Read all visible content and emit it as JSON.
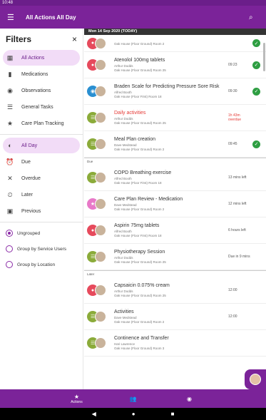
{
  "statusbar": {
    "time": "10:48"
  },
  "appbar": {
    "title": "All Actions All Day"
  },
  "drawer": {
    "title": "Filters",
    "close": "×",
    "items": [
      {
        "label": "All Actions",
        "icon": "grid-icon",
        "glyph": "▦",
        "active": true
      },
      {
        "label": "Medications",
        "icon": "pill-bottle-icon",
        "glyph": "▮",
        "active": false
      },
      {
        "label": "Observations",
        "icon": "eye-icon",
        "glyph": "◉",
        "active": false
      },
      {
        "label": "General Tasks",
        "icon": "checklist-icon",
        "glyph": "☰",
        "active": false
      },
      {
        "label": "Care Plan Tracking",
        "icon": "star-icon",
        "glyph": "★",
        "active": false
      },
      {
        "label": "All Day",
        "icon": "day-icon",
        "glyph": "◐",
        "active": true
      },
      {
        "label": "Due",
        "icon": "alarm-icon",
        "glyph": "⏰",
        "active": false
      },
      {
        "label": "Overdue",
        "icon": "overdue-icon",
        "glyph": "✕",
        "active": false
      },
      {
        "label": "Later",
        "icon": "snooze-icon",
        "glyph": "⏲",
        "active": false
      },
      {
        "label": "Previous",
        "icon": "calendar-check-icon",
        "glyph": "▣",
        "active": false
      }
    ],
    "grouping": [
      {
        "label": "Ungrouped",
        "selected": true
      },
      {
        "label": "Group by Service Users",
        "selected": false
      },
      {
        "label": "Group by Location",
        "selected": false
      }
    ]
  },
  "content": {
    "date_band": "Mon 14 Sep 2020 (TODAY)",
    "rows_top": [
      {
        "title": "",
        "person": "",
        "location": "Oak House (Floor Ground) Room 2",
        "time": "",
        "badge_color": "#e64a5c",
        "badge_glyph": "●",
        "done": true,
        "short": true
      },
      {
        "title": "Atenolol 100mg tablets",
        "person": "Arthur Dodds",
        "location": "Oak House (Floor Ground) Room 25",
        "time": "09:23",
        "badge_color": "#e64a5c",
        "badge_glyph": "●",
        "done": true
      },
      {
        "title": "Braden Scale for Predicting Pressure Sore Risk",
        "person": "Alfred Booth",
        "location": "Oak House (Floor First) Room 18",
        "time": "09:30",
        "badge_color": "#2a8fd1",
        "badge_glyph": "◉",
        "done": true
      },
      {
        "title": "Daily activities",
        "person": "Arthur Dodds",
        "location": "Oak House (Floor Ground) Room 25",
        "time": "1h 43m overdue",
        "badge_color": "#8bab3a",
        "badge_glyph": "☰",
        "done": false,
        "red": true
      },
      {
        "title": "Meal Plan creation",
        "person": "Dave Medstead",
        "location": "Oak House (Floor Ground) Room 2",
        "time": "09:45",
        "badge_color": "#8bab3a",
        "badge_glyph": "☰",
        "done": true
      }
    ],
    "section_due": "Due",
    "rows_due": [
      {
        "title": "COPD Breathing exercise",
        "person": "Alfred Booth",
        "location": "Oak House (Floor First) Room 18",
        "time": "13 mins left",
        "badge_color": "#8bab3a",
        "badge_glyph": "☰"
      },
      {
        "title": "Care Plan Review - Medication",
        "person": "Dave Medstead",
        "location": "Oak House (Floor Ground) Room 2",
        "time": "12 mins left",
        "badge_color": "#e879c8",
        "badge_glyph": "★"
      },
      {
        "title": "Aspirin 75mg tablets",
        "person": "Alfred Booth",
        "location": "Oak House (Floor First) Room 18",
        "time": "6 hours left",
        "badge_color": "#e64a5c",
        "badge_glyph": "●"
      },
      {
        "title": "Physiotherapy Session",
        "person": "Arthur Dodds",
        "location": "Oak House (Floor Ground) Room 25",
        "time": "Due in 9 mins",
        "badge_color": "#8bab3a",
        "badge_glyph": "☰"
      }
    ],
    "section_later": "Later",
    "rows_later": [
      {
        "title": "Capsaicin 0.075% cream",
        "person": "Arthur Dodds",
        "location": "Oak House (Floor Ground) Room 25",
        "time": "12:00",
        "badge_color": "#e64a5c",
        "badge_glyph": "●"
      },
      {
        "title": "Activities",
        "person": "Dave Medstead",
        "location": "Oak House (Floor Ground) Room 2",
        "time": "12:00",
        "badge_color": "#8bab3a",
        "badge_glyph": "☰"
      },
      {
        "title": "Continence and Transfer",
        "person": "Hari Lawrence",
        "location": "Oak House (Floor Ground) Room 3",
        "time": "",
        "badge_color": "#8bab3a",
        "badge_glyph": "☰"
      }
    ]
  },
  "bottomnav": {
    "actions_label": "Actions"
  },
  "colors": {
    "brand": "#7b2399",
    "done_green": "#2e9e42",
    "overdue_red": "#e53935"
  }
}
